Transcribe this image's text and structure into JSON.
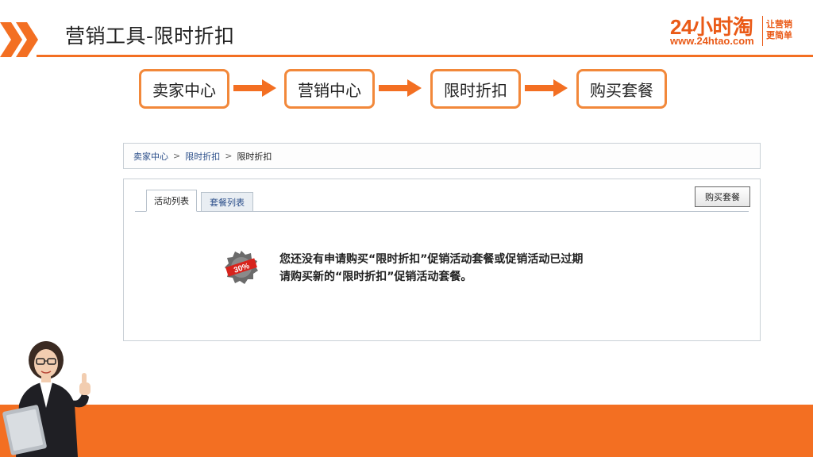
{
  "header": {
    "title": "营销工具-限时折扣",
    "accent_color": "#f36f22"
  },
  "brand": {
    "name": "24小时淘",
    "url": "www.24htao.com",
    "slogan_line1": "让营销",
    "slogan_line2": "更简单"
  },
  "flow": {
    "steps": [
      "卖家中心",
      "营销中心",
      "限时折扣",
      "购买套餐"
    ]
  },
  "breadcrumb": {
    "items": [
      "卖家中心",
      "限时折扣"
    ],
    "current": "限时折扣",
    "separator": ">"
  },
  "tabs": [
    {
      "label": "活动列表",
      "active": true
    },
    {
      "label": "套餐列表",
      "active": false
    }
  ],
  "buy_button": {
    "label": "购买套餐"
  },
  "badge": {
    "icon": "discount-badge-icon",
    "text": "30%"
  },
  "notice": {
    "line1": "您还没有申请购买“限时折扣”促销活动套餐或促销活动已过期",
    "line2": "请购买新的“限时折扣”促销活动套餐。"
  }
}
